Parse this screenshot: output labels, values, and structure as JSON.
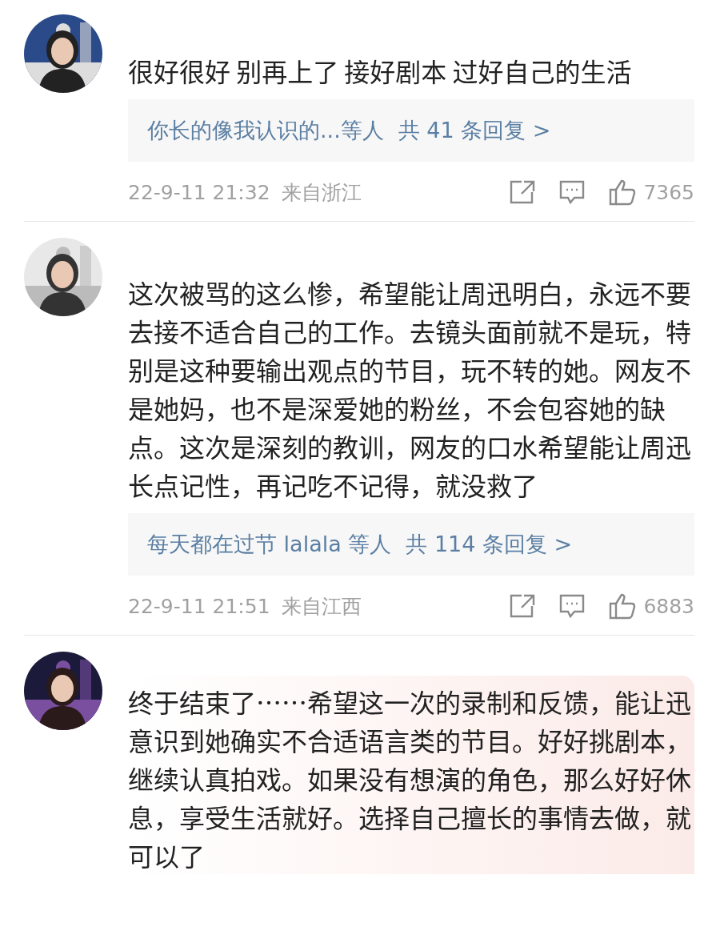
{
  "comments": [
    {
      "text": "很好很好 别再上了 接好剧本 过好自己的生活",
      "highlighted": false,
      "replies": {
        "users": "你长的像我认识的...等人",
        "count": "共 41 条回复 >"
      },
      "footer": {
        "time": "22-9-11 21:32",
        "location": "来自浙江",
        "likes": "7365"
      }
    },
    {
      "text": "这次被骂的这么惨，希望能让周迅明白，永远不要去接不适合自己的工作。去镜头面前就不是玩，特别是这种要输出观点的节目，玩不转的她。网友不是她妈，也不是深爱她的粉丝，不会包容她的缺点。这次是深刻的教训，网友的口水希望能让周迅长点记性，再记吃不记得，就没救了",
      "highlighted": false,
      "replies": {
        "users": "每天都在过节 lalala 等人",
        "count": "共 114 条回复 >"
      },
      "footer": {
        "time": "22-9-11 21:51",
        "location": "来自江西",
        "likes": "6883"
      }
    },
    {
      "text": "终于结束了……希望这一次的录制和反馈，能让迅意识到她确实不合适语言类的节目。好好挑剧本，继续认真拍戏。如果没有想演的角色，那么好好休息，享受生活就好。选择自己擅长的事情去做，就可以了",
      "highlighted": true
    }
  ]
}
